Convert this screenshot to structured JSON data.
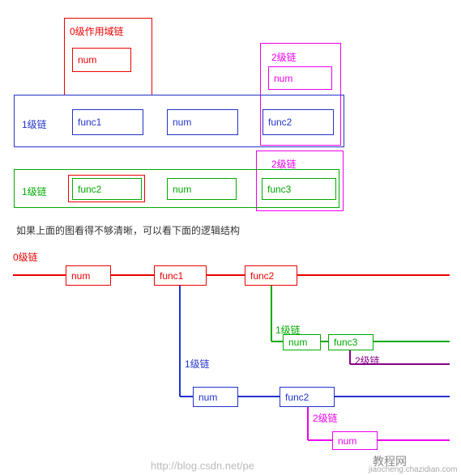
{
  "title_0": "0级作用域链",
  "num": "num",
  "f1": "func1",
  "f2": "func2",
  "f3": "func3",
  "c0": "0级链",
  "c1": "1级链",
  "c2": "2级链",
  "caption": "如果上面的图看得不够清晰，可以看下面的逻辑结构",
  "wm1": "http://blog.csdn.net/pe",
  "wm2": "教程网",
  "wm3": "jiaocheng.chazidian.com"
}
